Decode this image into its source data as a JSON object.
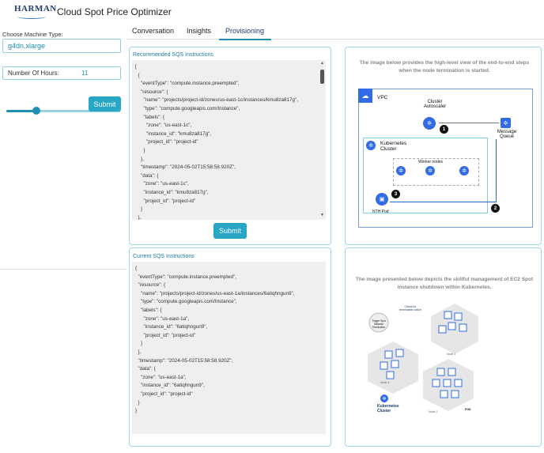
{
  "header": {
    "logo_text": "HARMAN",
    "app_title": "Cloud Spot Price Optimizer"
  },
  "sidebar": {
    "machine_type_label": "Choose Machine Type:",
    "machine_type_value": "g4dn.xlarge",
    "hours_label": "Number Of Hours:",
    "hours_value": "11",
    "hours_slider_fraction": 0.26,
    "submit_label": "Submit"
  },
  "tabs": [
    {
      "label": "Conversation"
    },
    {
      "label": "Insights"
    },
    {
      "label": "Provisioning",
      "active": true
    }
  ],
  "recommended": {
    "title": "Recommended SQS Instructions",
    "code": "[\n  {\n    \"eventType\": \"compute.instance.preempted\",\n    \"resource\": {\n      \"name\": \"projects/project-id/zones/us-east-1c/instances/kmu8za817g\",\n      \"type\": \"compute.googleapis.com/Instance\",\n      \"labels\": {\n        \"zone\": \"us-east-1c\",\n        \"instance_id\": \"kmu8za817g\",\n        \"project_id\": \"project-id\"\n      }\n    },\n    \"timestamp\": \"2024-05-02T15:58:58.920Z\",\n    \"data\": {\n      \"zone\": \"us-east-1c\",\n      \"instance_id\": \"kmu8za817g\",\n      \"project_id\": \"project-id\"\n    }\n  },",
    "submit_label": "Submit"
  },
  "current": {
    "title": "Current SQS Instructions",
    "code": "{\n  \"eventType\": \"compute.instance.preempted\",\n  \"resource\": {\n    \"name\": \"projects/project-id/zones/us-east-1a/instances/6atiqhngun9\",\n    \"type\": \"compute.googleapis.com/Instance\",\n    \"labels\": {\n      \"zone\": \"us-east-1a\",\n      \"instance_id\": \"6atiqhngun9\",\n      \"project_id\": \"project-id\"\n    }\n  },\n  \"timestamp\": \"2024-05-02T15:58:58.920Z\",\n  \"data\": {\n    \"zone\": \"us-east-1a\",\n    \"instance_id\": \"6atiqhngun9\",\n    \"project_id\": \"project-id\"\n  }\n}"
  },
  "diagram1": {
    "caption": "The image below provides the high-level view of the end-to-end steps when the node termination is started.",
    "vpc_label": "VPC",
    "autoscaler_label": "Cluster Autoscaler",
    "cluster_label": "Kubernetes Cluster",
    "worker_label": "Worker nodes",
    "queue_label": "Message Queue",
    "nth_label": "NTH Pod",
    "step1": "1",
    "step2": "2",
    "step3": "3"
  },
  "diagram2": {
    "caption": "The image presented below depicts the skillful management of EC2 Spot instance shutdown within Kubernetes.",
    "cluster_label": "Kubernetes Cluster",
    "check_label": "Check for termination notice",
    "trigger_label": "Trigger Spot Instance Termination",
    "node1": "Node 1",
    "node2": "Node 2",
    "node3": "Node 3",
    "pod_label": "POD"
  },
  "colors": {
    "accent": "#27a6c5",
    "border": "#9fd6e6",
    "k8s_blue": "#326ce5"
  }
}
